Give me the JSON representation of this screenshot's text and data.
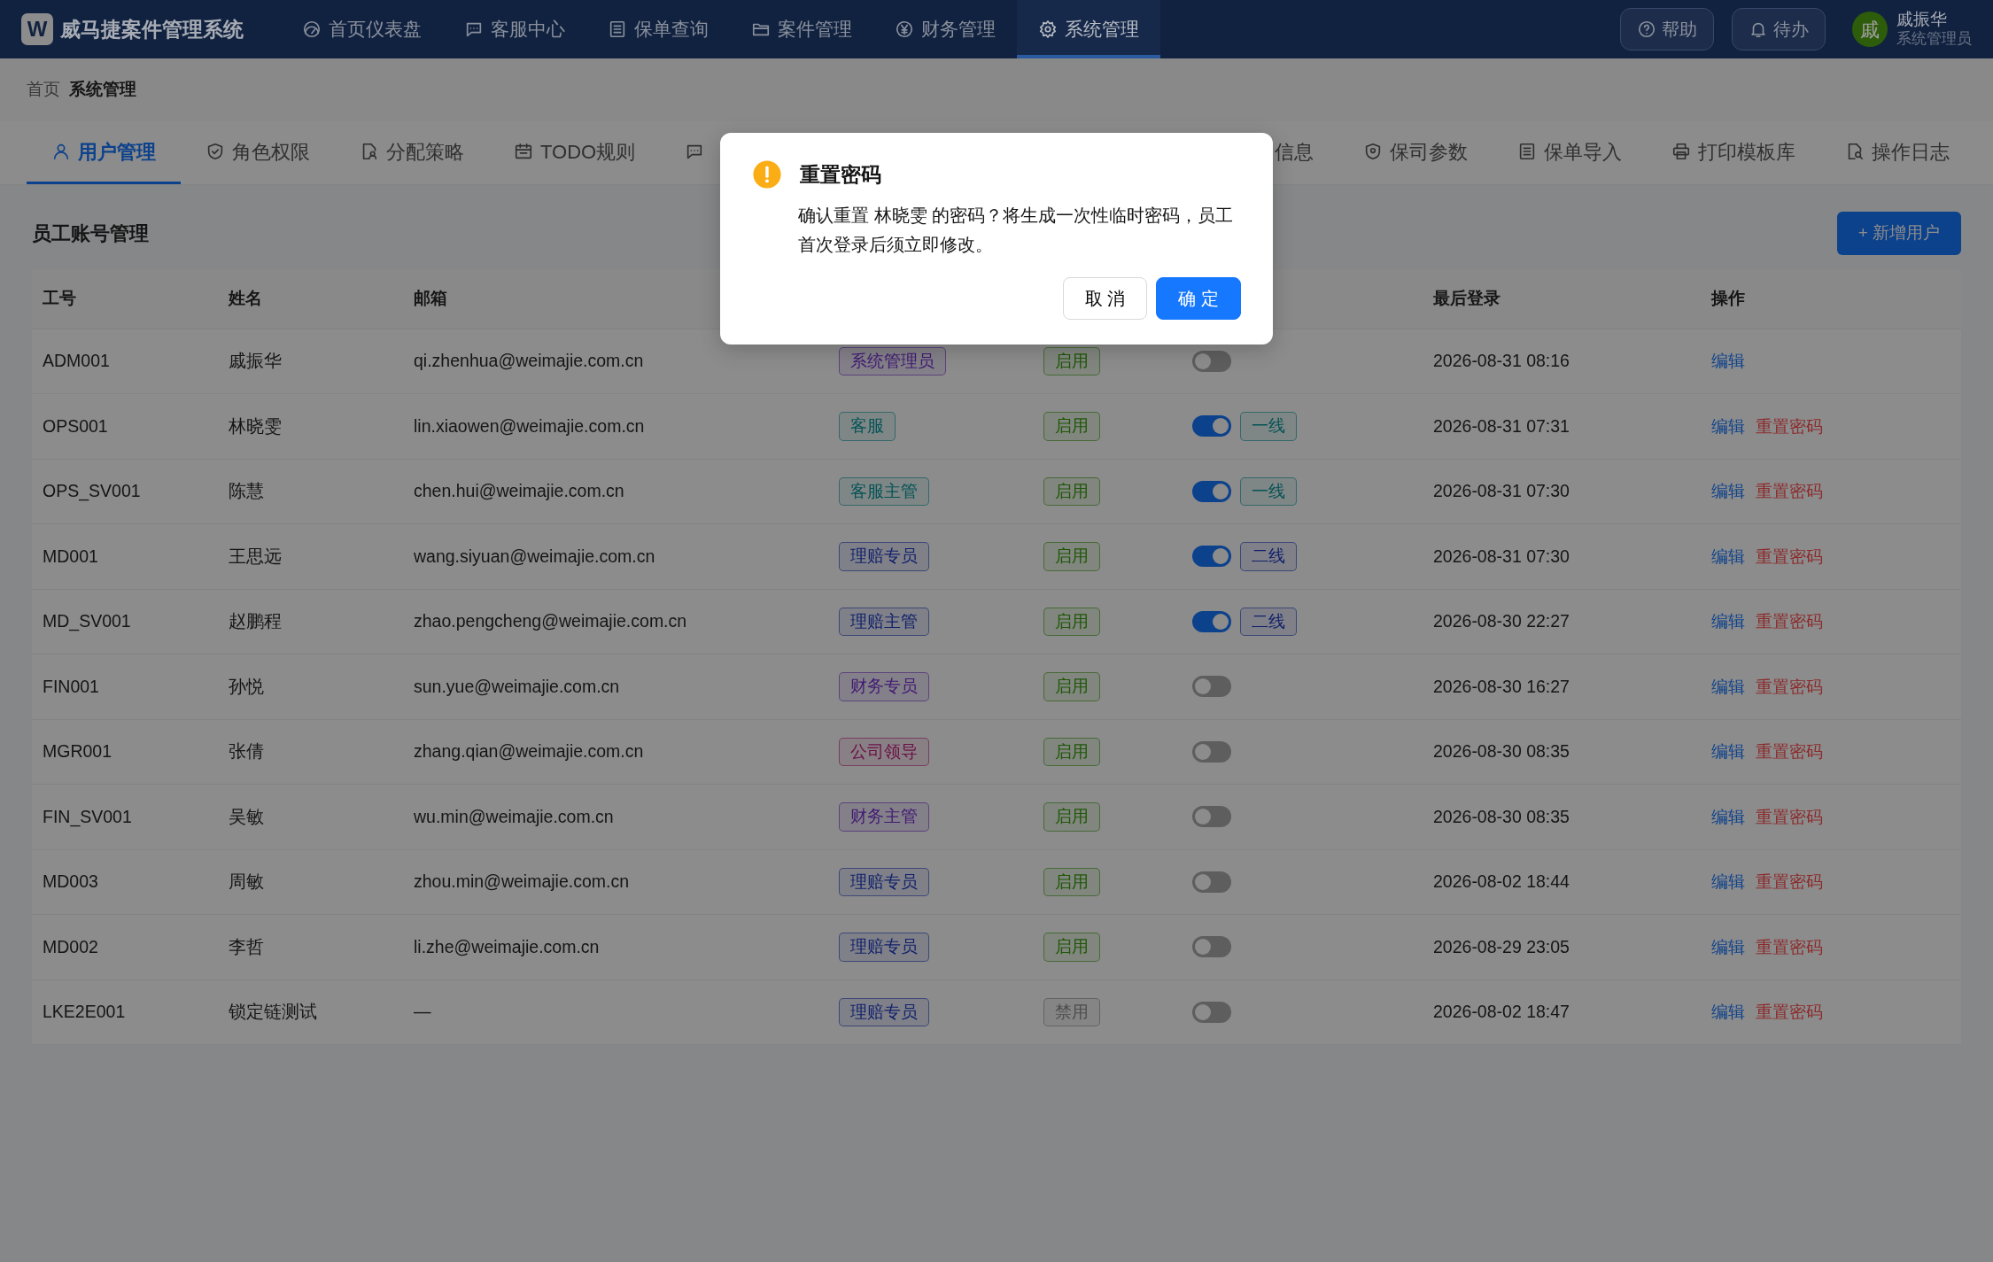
{
  "app": {
    "logo": "W",
    "title": "威马捷案件管理系统"
  },
  "nav": [
    {
      "label": "首页仪表盘",
      "selected": false
    },
    {
      "label": "客服中心",
      "selected": false
    },
    {
      "label": "保单查询",
      "selected": false
    },
    {
      "label": "案件管理",
      "selected": false
    },
    {
      "label": "财务管理",
      "selected": false
    },
    {
      "label": "系统管理",
      "selected": true
    }
  ],
  "header_buttons": [
    "帮助",
    "待办"
  ],
  "user": {
    "avatar": "戚",
    "name": "戚振华",
    "role": "系统管理员"
  },
  "breadcrumb": [
    "首页",
    "系统管理"
  ],
  "tabs": [
    {
      "label": "用户管理",
      "selected": true
    },
    {
      "label": "角色权限",
      "selected": false
    },
    {
      "label": "分配策略",
      "selected": false
    },
    {
      "label": "TODO规则",
      "selected": false
    },
    {
      "label": "信息",
      "selected": false,
      "kind": "covered"
    },
    {
      "label": "保司参数",
      "selected": false
    },
    {
      "label": "保单导入",
      "selected": false
    },
    {
      "label": "打印模板库",
      "selected": false
    },
    {
      "label": "操作日志",
      "selected": false
    }
  ],
  "section_title": "员工账号管理",
  "add_button": "+ 新增用户",
  "table": {
    "columns": [
      {
        "label": "工号"
      },
      {
        "label": "姓名"
      },
      {
        "label": "邮箱"
      },
      {},
      {},
      {},
      {
        "label": "最后登录"
      },
      {
        "label": "操作"
      }
    ],
    "rows": [
      {
        "id": "ADM001",
        "name": "戚振华",
        "email": "qi.zhenhua@weimajie.com.cn",
        "role": {
          "label": "系统管理员",
          "color": "#3f1973"
        },
        "status": {
          "label": "启用",
          "color": "#1f5707"
        },
        "on": false,
        "last_login": "2026-08-31 08:16",
        "actions": [
          {
            "label": "编辑",
            "kind": "edit"
          }
        ]
      },
      {
        "id": "OPS001",
        "name": "林晓雯",
        "email": "lin.xiaowen@weimajie.com.cn",
        "role": {
          "label": "客服",
          "color": "#055356"
        },
        "status": {
          "label": "启用",
          "color": "#1f5707"
        },
        "on": true,
        "line": {
          "label": "一线",
          "color": "#055356"
        },
        "last_login": "2026-08-31 07:31",
        "actions": [
          {
            "label": "编辑",
            "kind": "edit"
          },
          {
            "label": "重置密码",
            "kind": "danger"
          }
        ]
      },
      {
        "id": "OPS_SV001",
        "name": "陈慧",
        "email": "chen.hui@weimajie.com.cn",
        "role": {
          "label": "客服主管",
          "color": "#055356"
        },
        "status": {
          "label": "启用",
          "color": "#1f5707"
        },
        "on": true,
        "line": {
          "label": "一线",
          "color": "#055356"
        },
        "last_login": "2026-08-31 07:30",
        "actions": [
          {
            "label": "编辑",
            "kind": "edit"
          },
          {
            "label": "重置密码",
            "kind": "danger"
          }
        ]
      },
      {
        "id": "MD001",
        "name": "王思远",
        "email": "wang.siyuan@weimajie.com.cn",
        "role": {
          "label": "理赔专员",
          "color": "#10206c"
        },
        "status": {
          "label": "启用",
          "color": "#1f5707"
        },
        "on": true,
        "line": {
          "label": "二线",
          "color": "#10206c"
        },
        "last_login": "2026-08-31 07:30",
        "actions": [
          {
            "label": "编辑",
            "kind": "edit"
          },
          {
            "label": "重置密码",
            "kind": "danger"
          }
        ]
      },
      {
        "id": "MD_SV001",
        "name": "赵鹏程",
        "email": "zhao.pengcheng@weimajie.com.cn",
        "role": {
          "label": "理赔主管",
          "color": "#10206c"
        },
        "status": {
          "label": "启用",
          "color": "#1f5707"
        },
        "on": true,
        "line": {
          "label": "二线",
          "color": "#10206c"
        },
        "last_login": "2026-08-30 22:27",
        "actions": [
          {
            "label": "编辑",
            "kind": "edit"
          },
          {
            "label": "重置密码",
            "kind": "danger"
          }
        ]
      },
      {
        "id": "FIN001",
        "name": "孙悦",
        "email": "sun.yue@weimajie.com.cn",
        "role": {
          "label": "财务专员",
          "color": "#3f1973"
        },
        "status": {
          "label": "启用",
          "color": "#1f5707"
        },
        "on": false,
        "last_login": "2026-08-30 16:27",
        "actions": [
          {
            "label": "编辑",
            "kind": "edit"
          },
          {
            "label": "重置密码",
            "kind": "danger"
          }
        ]
      },
      {
        "id": "MGR001",
        "name": "张倩",
        "email": "zhang.qian@weimajie.com.cn",
        "role": {
          "label": "公司领导",
          "color": "#6c1046"
        },
        "status": {
          "label": "启用",
          "color": "#1f5707"
        },
        "on": false,
        "last_login": "2026-08-30 08:35",
        "actions": [
          {
            "label": "编辑",
            "kind": "edit"
          },
          {
            "label": "重置密码",
            "kind": "danger"
          }
        ]
      },
      {
        "id": "FIN_SV001",
        "name": "吴敏",
        "email": "wu.min@weimajie.com.cn",
        "role": {
          "label": "财务主管",
          "color": "#3f1973"
        },
        "status": {
          "label": "启用",
          "color": "#1f5707"
        },
        "on": false,
        "last_login": "2026-08-30 08:35",
        "actions": [
          {
            "label": "编辑",
            "kind": "edit"
          },
          {
            "label": "重置密码",
            "kind": "danger"
          }
        ]
      },
      {
        "id": "MD003",
        "name": "周敏",
        "email": "zhou.min@weimajie.com.cn",
        "role": {
          "label": "理赔专员",
          "color": "#10206c"
        },
        "status": {
          "label": "启用",
          "color": "#1f5707"
        },
        "on": false,
        "last_login": "2026-08-02 18:44",
        "actions": [
          {
            "label": "编辑",
            "kind": "edit"
          },
          {
            "label": "重置密码",
            "kind": "danger"
          }
        ]
      },
      {
        "id": "MD002",
        "name": "李哲",
        "email": "li.zhe@weimajie.com.cn",
        "role": {
          "label": "理赔专员",
          "color": "#10206c"
        },
        "status": {
          "label": "启用",
          "color": "#1f5707"
        },
        "on": false,
        "last_login": "2026-08-29 23:05",
        "actions": [
          {
            "label": "编辑",
            "kind": "edit"
          },
          {
            "label": "重置密码",
            "kind": "danger"
          }
        ]
      },
      {
        "id": "LKE2E001",
        "name": "锁定链测试",
        "email": "—",
        "role": {
          "label": "理赔专员",
          "color": "#10206c"
        },
        "status": {
          "label": "禁用",
          "color": "#4d4d4d"
        },
        "on": false,
        "last_login": "2026-08-02 18:47",
        "actions": [
          {
            "label": "编辑",
            "kind": "edit"
          },
          {
            "label": "重置密码",
            "kind": "danger"
          }
        ]
      }
    ]
  },
  "dialog": {
    "title": "重置密码",
    "message": "确认重置 林晓雯 的密码？将生成一次性临时密码，员工首次登录后须立即修改。",
    "buttons": [
      {
        "label": "取 消",
        "kind": "default"
      },
      {
        "label": "确 定",
        "kind": "primary"
      }
    ]
  }
}
